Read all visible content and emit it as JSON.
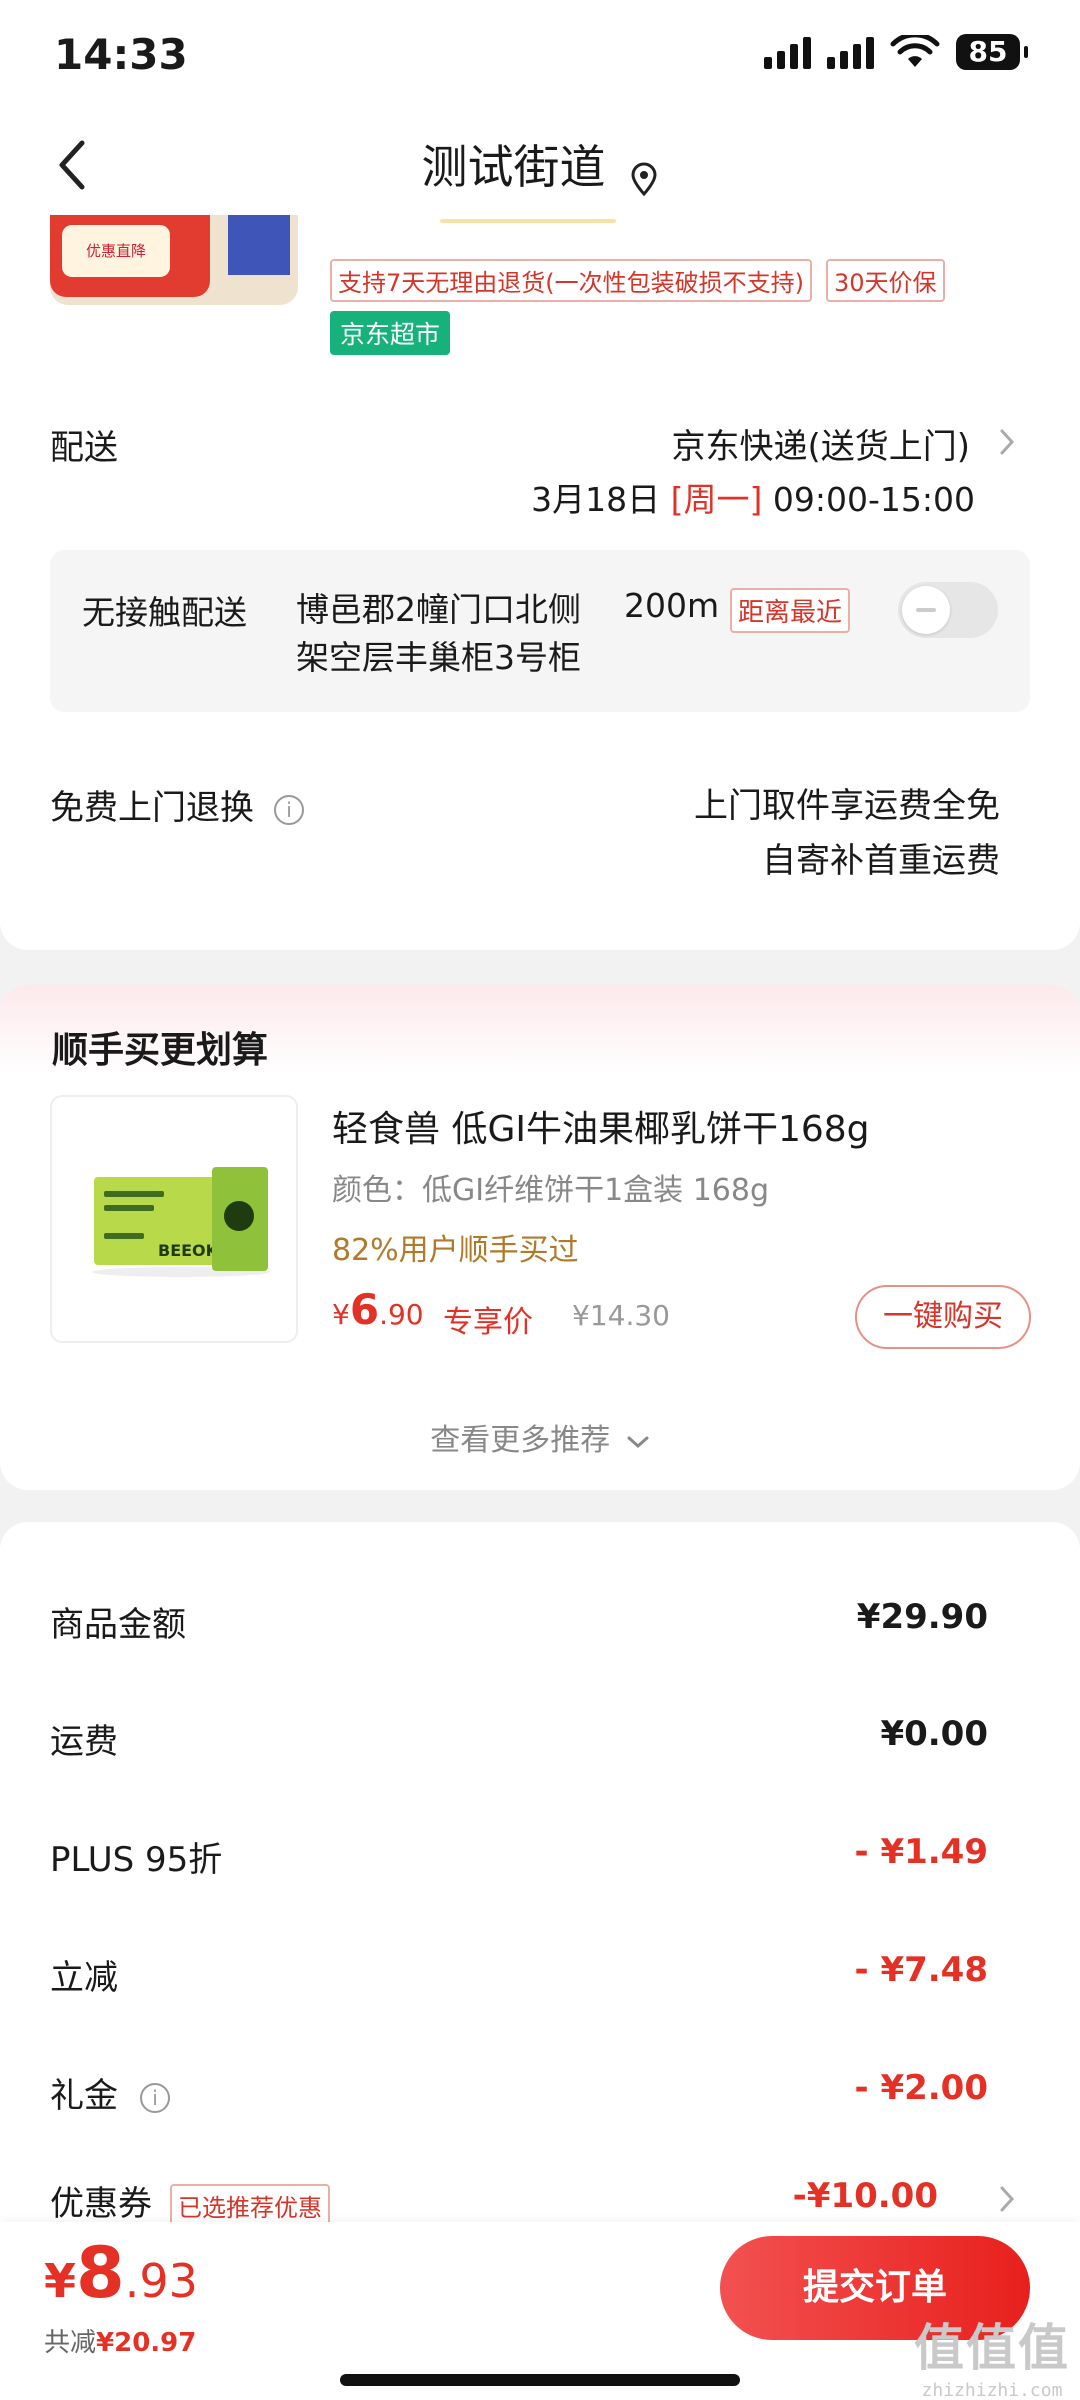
{
  "status_bar": {
    "time": "14:33",
    "battery": "85"
  },
  "nav": {
    "title": "测试街道"
  },
  "product": {
    "thumb_badge": "优惠直降",
    "tags": [
      "支持7天无理由退货(一次性包装破损不支持)",
      "30天价保"
    ],
    "store_tag": "京东超市"
  },
  "delivery": {
    "label": "配送",
    "company": "京东快递(送货上门)",
    "date": "3月18日",
    "weekday": "[周一]",
    "time_range": "09:00-15:00"
  },
  "contactless": {
    "label": "无接触配送",
    "address_line1": "博邑郡2幢门口北侧",
    "distance": "200m",
    "nearest_tag": "距离最近",
    "address_line2": "架空层丰巢柜3号柜",
    "toggle_on": false
  },
  "returns": {
    "label": "免费上门退换",
    "line1": "上门取件享运费全免",
    "line2": "自寄补首重运费"
  },
  "recommend": {
    "title": "顺手买更划算",
    "item": {
      "name": "轻食兽 低GI牛油果椰乳饼干168g",
      "spec": "颜色：低GI纤维饼干1盒装 168g",
      "bought": "82%用户顺手买过",
      "price_symbol": "¥",
      "price_int": "6",
      "price_dec": ".90",
      "price_label": "专享价",
      "original_price": "¥14.30",
      "buy_label": "一键购买",
      "box_text": "BEEOK"
    },
    "more_label": "查看更多推荐"
  },
  "summary": {
    "rows": [
      {
        "label": "商品金额",
        "value": "¥29.90"
      },
      {
        "label": "运费",
        "value": "¥0.00"
      },
      {
        "label": "PLUS 95折",
        "value": "- ¥1.49"
      },
      {
        "label": "立减",
        "value": "- ¥7.48"
      },
      {
        "label": "礼金",
        "value": "- ¥2.00"
      },
      {
        "label": "优惠券",
        "value": "-¥10.00",
        "tag": "已选推荐优惠"
      }
    ]
  },
  "footer": {
    "total_symbol": "¥",
    "total_int": "8",
    "total_dec": ".93",
    "save_label": "共减",
    "save_amount": "¥20.97",
    "submit_label": "提交订单",
    "watermark_logo": "值值值",
    "watermark_url": "zhizhizhi.com"
  },
  "colors": {
    "accent_red": "#e53125",
    "store_green": "#17b27c",
    "bought_gold": "#b07a2a"
  }
}
